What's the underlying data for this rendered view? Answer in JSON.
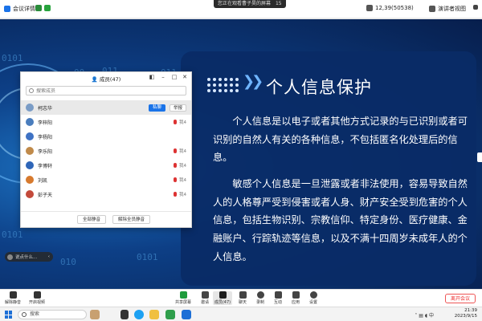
{
  "app": {
    "meeting_details": "会议详情",
    "share_banner": "您正在观看曹子昊的屏幕",
    "share_banner_badge": "15",
    "participants_count_short": "12,39(50538)",
    "view_label": "演讲者视图"
  },
  "slide": {
    "title": "个人信息保护",
    "para1": "个人信息是以电子或者其他方式记录的与已识别或者可识别的自然人有关的各种信息，不包括匿名化处理后的信息。",
    "para2": "敏感个人信息是一旦泄露或者非法使用，容易导致自然人的人格尊严受到侵害或者人身、财产安全受到危害的个人信息，包括生物识别、宗教信仰、特定身份、医疗健康、金融账户、行踪轨迹等信息，以及不满十四周岁未成年人的个人信息。",
    "deco_numbers": [
      "00",
      "011",
      "011",
      "00",
      "011",
      "0101",
      "0101",
      "010",
      "0101"
    ]
  },
  "participants": {
    "title": "成员(47)",
    "search_placeholder": "搜索成员",
    "items": [
      {
        "name": "柯志华",
        "tag": "",
        "avatar_color": "#7a9cc6",
        "first": true
      },
      {
        "name": "李梓阳",
        "tag": "我4",
        "avatar_color": "#4a7dbd"
      },
      {
        "name": "李杨阳",
        "tag": "",
        "avatar_color": "#3f72c4"
      },
      {
        "name": "李乐阳",
        "tag": "我4",
        "avatar_color": "#c08a4a"
      },
      {
        "name": "李博轩",
        "tag": "我4",
        "avatar_color": "#2f66b8"
      },
      {
        "name": "刘凯",
        "tag": "我4",
        "avatar_color": "#d77a2e"
      },
      {
        "name": "彭子天",
        "tag": "我4",
        "avatar_color": "#c34a3b"
      }
    ],
    "mute_all_label": "全部静音",
    "unmute_all_label": "解除全员静音",
    "row_btn_primary": "私聊",
    "row_btn_secondary": "举报"
  },
  "chat": {
    "preview": "说点什么..."
  },
  "toolbar": {
    "left": [
      {
        "label": "解除静音"
      },
      {
        "label": "开启视频"
      }
    ],
    "center": [
      {
        "label": "共享屏幕"
      },
      {
        "label": "邀请"
      },
      {
        "label": "成员(47)"
      },
      {
        "label": "聊天"
      },
      {
        "label": "录制"
      },
      {
        "label": "互动"
      },
      {
        "label": "应用"
      },
      {
        "label": "设置"
      }
    ],
    "leave_label": "离开会议"
  },
  "taskbar": {
    "search_placeholder": "搜索",
    "time": "21:39",
    "date": "2023/9/15",
    "lang": "中"
  },
  "colors": {
    "accent": "#1a73e8",
    "slide_bg": "#0a2b66",
    "leave": "#e33333"
  }
}
